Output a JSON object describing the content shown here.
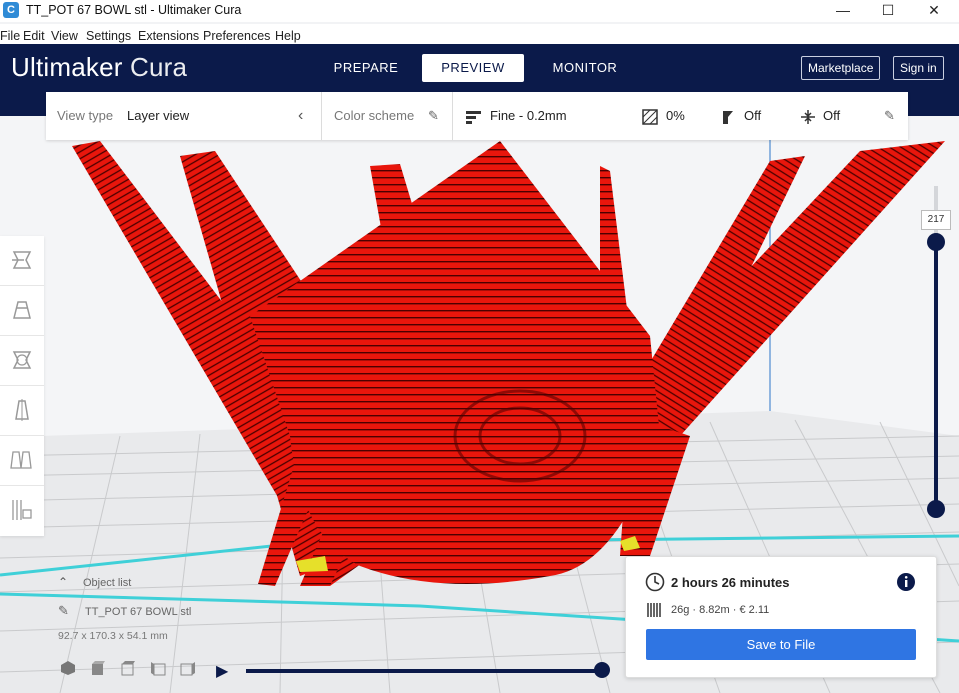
{
  "window": {
    "title": "TT_POT 67 BOWL stl - Ultimaker Cura",
    "app_icon_letter": "C",
    "controls": {
      "minimize": "—",
      "maximize": "☐",
      "close": "✕"
    }
  },
  "menu": [
    "File",
    "Edit",
    "View",
    "Settings",
    "Extensions",
    "Preferences",
    "Help"
  ],
  "header": {
    "logo_bold": "Ultimaker",
    "logo_light": "Cura",
    "tabs": [
      {
        "label": "PREPARE",
        "active": false
      },
      {
        "label": "PREVIEW",
        "active": true
      },
      {
        "label": "MONITOR",
        "active": false
      }
    ],
    "marketplace_label": "Marketplace",
    "signin_label": "Sign in"
  },
  "toolbar": {
    "view_type_label": "View type",
    "view_type_value": "Layer view",
    "color_scheme_label": "Color scheme",
    "profile_value": "Fine - 0.2mm",
    "infill_value": "0%",
    "support_value": "Off",
    "adhesion_value": "Off"
  },
  "left_tools": [
    {
      "icon": "move-icon"
    },
    {
      "icon": "scale-icon"
    },
    {
      "icon": "rotate-icon"
    },
    {
      "icon": "mirror-icon"
    },
    {
      "icon": "per-model-settings-icon"
    },
    {
      "icon": "support-blocker-icon"
    }
  ],
  "object_list": {
    "header": "Object list",
    "object_name": "TT_POT 67 BOWL stl",
    "dimensions": "92.7 x 170.3 x 54.1 mm"
  },
  "layer_slider": {
    "current_layer": "217",
    "level": 1.0
  },
  "path_slider": {
    "level": 1.0
  },
  "print_info": {
    "time": "2 hours 26 minutes",
    "material": "26g · 8.82m · € 2.11",
    "save_label": "Save to File"
  },
  "colors": {
    "header_bg": "#0b1a4a",
    "model_red": "#e8160c",
    "accent_blue": "#2f75e3"
  }
}
